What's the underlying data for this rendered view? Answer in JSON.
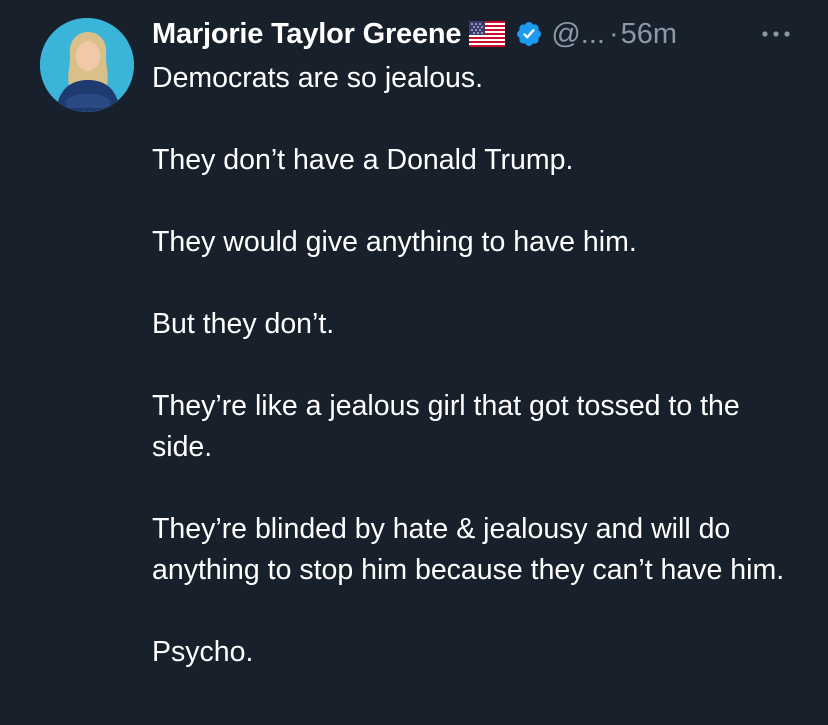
{
  "tweet": {
    "author": {
      "name": "Marjorie Taylor Greene",
      "flag_icon": "us-flag-icon",
      "verified_icon": "verified-badge-icon",
      "verified_color": "#1d9bf0",
      "handle": "@...",
      "separator": "·",
      "timestamp": "56m"
    },
    "more_icon": "more-horizontal-icon",
    "paragraphs": [
      "Democrats are so jealous.",
      "They don’t have a Donald Trump.",
      "They would give anything to have him.",
      "But they don’t.",
      "They’re like a jealous girl that got tossed to the side.",
      "They’re blinded by hate & jealousy and will do anything to stop him because they can’t have him.",
      "Psycho."
    ]
  },
  "colors": {
    "background": "#17202b",
    "text_primary": "#ffffff",
    "text_secondary": "#8b98a5",
    "accent": "#1d9bf0"
  }
}
